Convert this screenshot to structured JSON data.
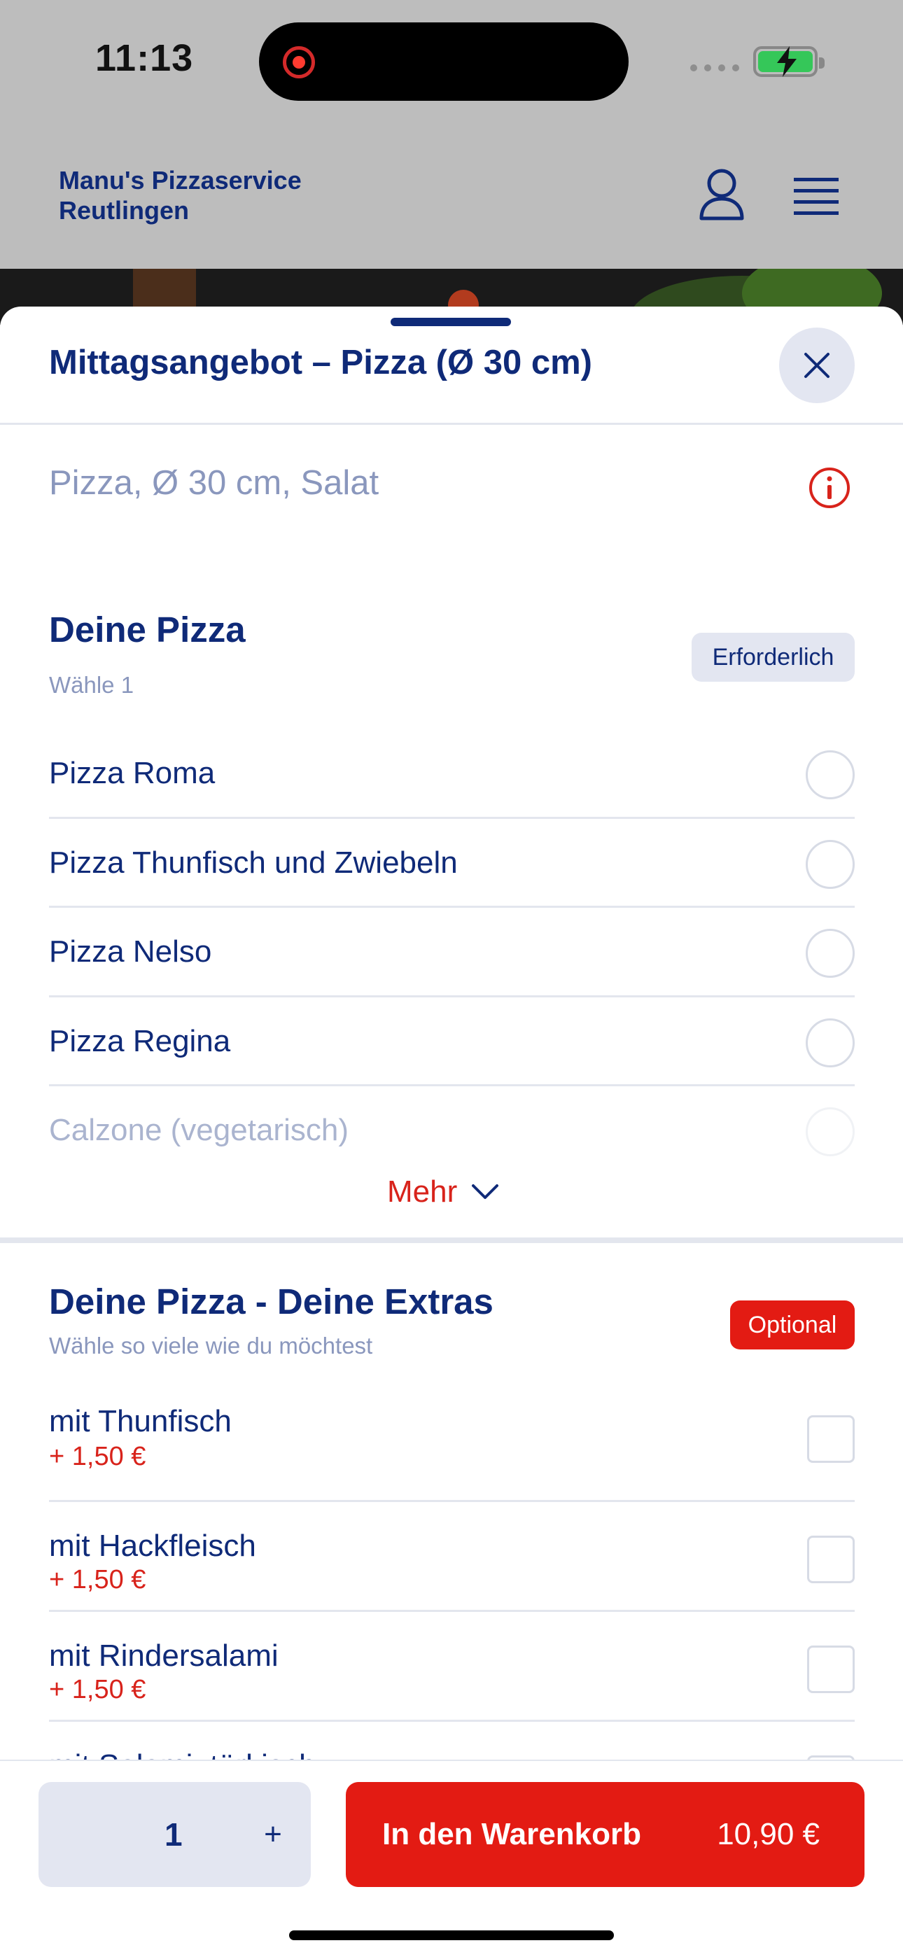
{
  "status_bar": {
    "time": "11:13"
  },
  "header": {
    "brand_line1": "Manu's Pizzaservice",
    "brand_line2": "Reutlingen"
  },
  "sheet": {
    "title": "Mittagsangebot – Pizza (Ø 30 cm)",
    "subtitle": "Pizza, Ø 30 cm, Salat"
  },
  "section_pizza": {
    "title": "Deine Pizza",
    "subtitle": "Wähle 1",
    "badge": "Erforderlich",
    "items": [
      {
        "label": "Pizza Roma"
      },
      {
        "label": "Pizza Thunfisch und Zwiebeln"
      },
      {
        "label": "Pizza Nelso"
      },
      {
        "label": "Pizza Regina"
      },
      {
        "label": "Calzone (vegetarisch)"
      }
    ],
    "more_label": "Mehr"
  },
  "section_extras": {
    "title": "Deine Pizza - Deine Extras",
    "subtitle": "Wähle so viele wie du möchtest",
    "badge": "Optional",
    "items": [
      {
        "label": "mit Thunfisch",
        "price": "+ 1,50 €"
      },
      {
        "label": "mit Hackfleisch",
        "price": "+ 1,50 €"
      },
      {
        "label": "mit Rindersalami",
        "price": "+ 1,50 €"
      },
      {
        "label": "mit Salami, türkisch"
      }
    ]
  },
  "bottom_bar": {
    "quantity": "1",
    "plus": "+",
    "cart_label": "In den Warenkorb",
    "cart_price": "10,90 €"
  },
  "colors": {
    "brand": "#0f2a78",
    "accent": "#e31b13",
    "muted": "#8a97bd"
  }
}
